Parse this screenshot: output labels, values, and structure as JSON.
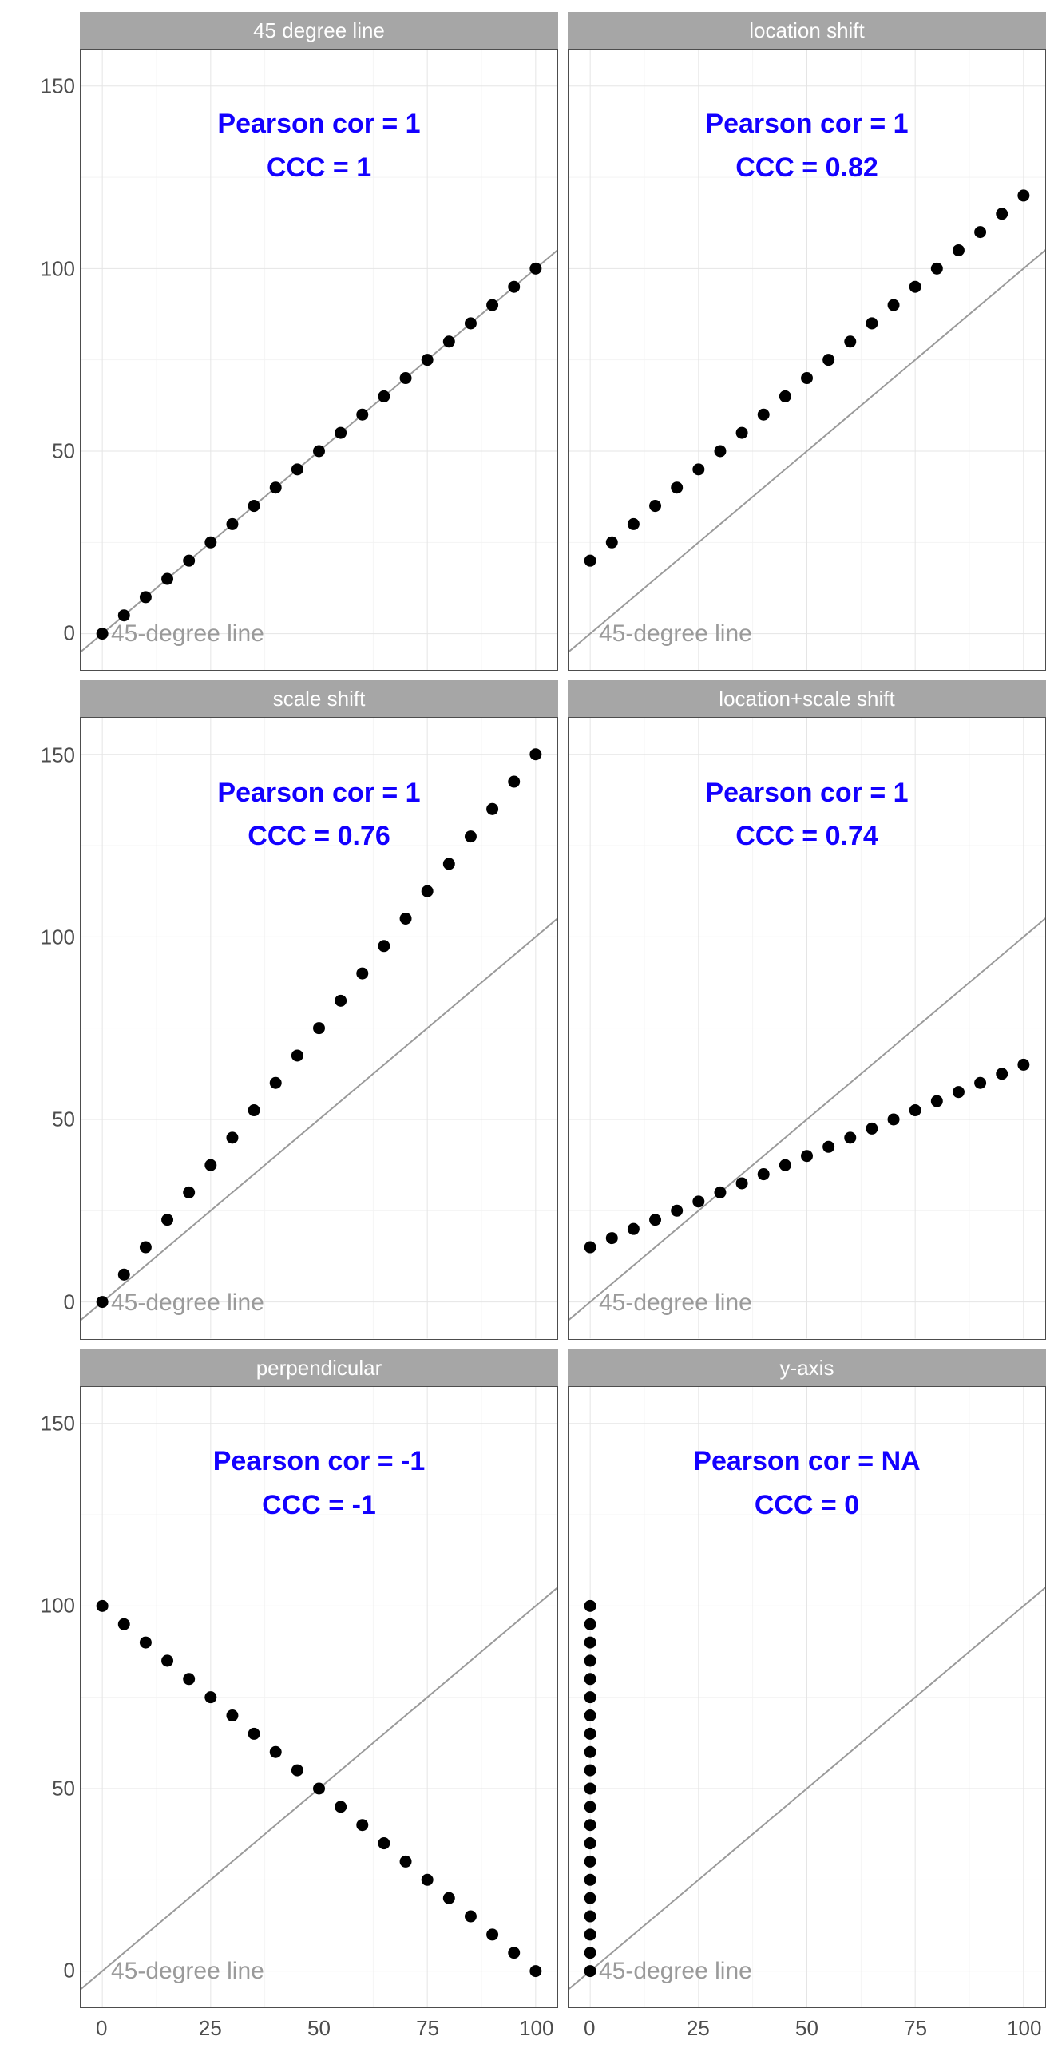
{
  "chart_data": [
    {
      "type": "scatter",
      "title": "45 degree line",
      "x": [
        0,
        5,
        10,
        15,
        20,
        25,
        30,
        35,
        40,
        45,
        50,
        55,
        60,
        65,
        70,
        75,
        80,
        85,
        90,
        95,
        100
      ],
      "y": [
        0,
        5,
        10,
        15,
        20,
        25,
        30,
        35,
        40,
        45,
        50,
        55,
        60,
        65,
        70,
        75,
        80,
        85,
        90,
        95,
        100
      ],
      "xlim": [
        -5,
        105
      ],
      "ylim": [
        -10,
        160
      ],
      "ann_pearson": "Pearson cor = 1",
      "ann_ccc": "CCC = 1",
      "ref_label": "45-degree line",
      "ref_line": {
        "x0": -10,
        "y0": -10,
        "x1": 110,
        "y1": 110
      }
    },
    {
      "type": "scatter",
      "title": "location shift",
      "x": [
        0,
        5,
        10,
        15,
        20,
        25,
        30,
        35,
        40,
        45,
        50,
        55,
        60,
        65,
        70,
        75,
        80,
        85,
        90,
        95,
        100
      ],
      "y": [
        20,
        25,
        30,
        35,
        40,
        45,
        50,
        55,
        60,
        65,
        70,
        75,
        80,
        85,
        90,
        95,
        100,
        105,
        110,
        115,
        120
      ],
      "xlim": [
        -5,
        105
      ],
      "ylim": [
        -10,
        160
      ],
      "ann_pearson": "Pearson cor = 1",
      "ann_ccc": "CCC = 0.82",
      "ref_label": "45-degree line",
      "ref_line": {
        "x0": -10,
        "y0": -10,
        "x1": 110,
        "y1": 110
      }
    },
    {
      "type": "scatter",
      "title": "scale shift",
      "x": [
        0,
        5,
        10,
        15,
        20,
        25,
        30,
        35,
        40,
        45,
        50,
        55,
        60,
        65,
        70,
        75,
        80,
        85,
        90,
        95,
        100
      ],
      "y": [
        0,
        7.5,
        15,
        22.5,
        30,
        37.5,
        45,
        52.5,
        60,
        67.5,
        75,
        82.5,
        90,
        97.5,
        105,
        112.5,
        120,
        127.5,
        135,
        142.5,
        150
      ],
      "xlim": [
        -5,
        105
      ],
      "ylim": [
        -10,
        160
      ],
      "ann_pearson": "Pearson cor = 1",
      "ann_ccc": "CCC = 0.76",
      "ref_label": "45-degree line",
      "ref_line": {
        "x0": -10,
        "y0": -10,
        "x1": 110,
        "y1": 110
      }
    },
    {
      "type": "scatter",
      "title": "location+scale shift",
      "x": [
        0,
        5,
        10,
        15,
        20,
        25,
        30,
        35,
        40,
        45,
        50,
        55,
        60,
        65,
        70,
        75,
        80,
        85,
        90,
        95,
        100
      ],
      "y": [
        15,
        17.5,
        20,
        22.5,
        25,
        27.5,
        30,
        32.5,
        35,
        37.5,
        40,
        42.5,
        45,
        47.5,
        50,
        52.5,
        55,
        57.5,
        60,
        62.5,
        65
      ],
      "xlim": [
        -5,
        105
      ],
      "ylim": [
        -10,
        160
      ],
      "ann_pearson": "Pearson cor = 1",
      "ann_ccc": "CCC = 0.74",
      "ref_label": "45-degree line",
      "ref_line": {
        "x0": -10,
        "y0": -10,
        "x1": 110,
        "y1": 110
      }
    },
    {
      "type": "scatter",
      "title": "perpendicular",
      "x": [
        0,
        5,
        10,
        15,
        20,
        25,
        30,
        35,
        40,
        45,
        50,
        55,
        60,
        65,
        70,
        75,
        80,
        85,
        90,
        95,
        100
      ],
      "y": [
        100,
        95,
        90,
        85,
        80,
        75,
        70,
        65,
        60,
        55,
        50,
        45,
        40,
        35,
        30,
        25,
        20,
        15,
        10,
        5,
        0
      ],
      "xlim": [
        -5,
        105
      ],
      "ylim": [
        -10,
        160
      ],
      "ann_pearson": "Pearson cor = -1",
      "ann_ccc": "CCC = -1",
      "ref_label": "45-degree line",
      "ref_line": {
        "x0": -10,
        "y0": -10,
        "x1": 110,
        "y1": 110
      }
    },
    {
      "type": "scatter",
      "title": "y-axis",
      "x": [
        0,
        0,
        0,
        0,
        0,
        0,
        0,
        0,
        0,
        0,
        0,
        0,
        0,
        0,
        0,
        0,
        0,
        0,
        0,
        0,
        0
      ],
      "y": [
        0,
        5,
        10,
        15,
        20,
        25,
        30,
        35,
        40,
        45,
        50,
        55,
        60,
        65,
        70,
        75,
        80,
        85,
        90,
        95,
        100
      ],
      "xlim": [
        -5,
        105
      ],
      "ylim": [
        -10,
        160
      ],
      "ann_pearson": "Pearson cor = NA",
      "ann_ccc": "CCC = 0",
      "ref_label": "45-degree line",
      "ref_line": {
        "x0": -10,
        "y0": -10,
        "x1": 110,
        "y1": 110
      }
    }
  ],
  "layout": {
    "x_ticks": [
      0,
      25,
      50,
      75,
      100
    ],
    "y_ticks": [
      0,
      50,
      100,
      150
    ],
    "x_minor": [
      12.5,
      37.5,
      62.5,
      87.5
    ],
    "y_minor": [
      25,
      75,
      125
    ]
  }
}
